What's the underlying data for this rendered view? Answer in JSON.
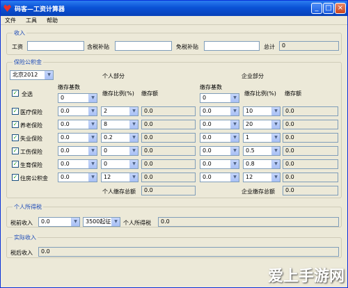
{
  "window": {
    "title": "码客—工资计算器",
    "min": "_",
    "max": "□",
    "close": "×"
  },
  "menu": [
    "文件",
    "工具",
    "帮助"
  ],
  "income": {
    "title": "收入",
    "salary": "工资",
    "tax_sub": "含税补贴",
    "free_sub": "免税补贴",
    "total": "总计",
    "total_val": "0"
  },
  "ins": {
    "title": "保险公积金",
    "city": "北京2012",
    "personal": "个人部分",
    "company": "企业部分",
    "select_all": "全选",
    "base": "缴存基数",
    "ratio": "缴存比例(%)",
    "amount": "缴存额",
    "p_base_top": "0",
    "c_base_top": "0",
    "rows": [
      {
        "name": "医疗保险",
        "pb": "0.0",
        "pr": "2",
        "pa": "0.0",
        "cb": "0.0",
        "cr": "10",
        "ca": "0.0"
      },
      {
        "name": "养老保险",
        "pb": "0.0",
        "pr": "8",
        "pa": "0.0",
        "cb": "0.0",
        "cr": "20",
        "ca": "0.0"
      },
      {
        "name": "失业保险",
        "pb": "0.0",
        "pr": "0.2",
        "pa": "0.0",
        "cb": "0.0",
        "cr": "1",
        "ca": "0.0"
      },
      {
        "name": "工伤保险",
        "pb": "0.0",
        "pr": "0",
        "pa": "0.0",
        "cb": "0.0",
        "cr": "0.5",
        "ca": "0.0"
      },
      {
        "name": "生育保险",
        "pb": "0.0",
        "pr": "0",
        "pa": "0.0",
        "cb": "0.0",
        "cr": "0.8",
        "ca": "0.0"
      },
      {
        "name": "住房公积金",
        "pb": "0.0",
        "pr": "12",
        "pa": "0.0",
        "cb": "0.0",
        "cr": "12",
        "ca": "0.0"
      }
    ],
    "p_total": "个人缴存总额",
    "p_total_val": "0.0",
    "c_total": "企业缴存总额",
    "c_total_val": "0.0"
  },
  "tax": {
    "title": "个人所得税",
    "pre": "税前收入",
    "pre_val": "0.0",
    "threshold": "3500起征",
    "label": "个人所得税",
    "val": "0.0"
  },
  "actual": {
    "title": "实际收入",
    "after": "税后收入",
    "after_val": "0.0"
  },
  "watermark": "爱上手游网"
}
